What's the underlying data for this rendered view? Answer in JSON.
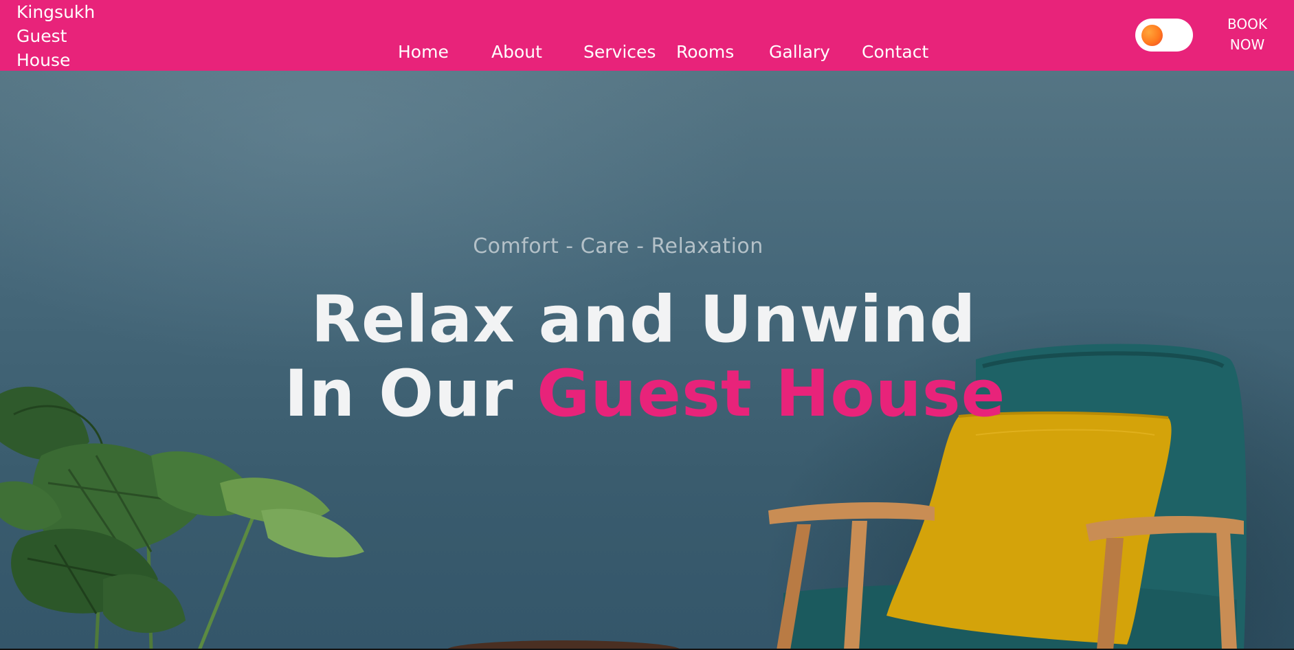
{
  "header": {
    "logo_lines": [
      "Kingsukh",
      "Guest",
      "House"
    ],
    "nav": [
      "Home",
      "About",
      "Services",
      "Rooms",
      "Gallary",
      "Contact"
    ],
    "book_now_lines": [
      "BOOK",
      "NOW"
    ],
    "theme_toggle": "theme-toggle"
  },
  "hero": {
    "tagline": "Comfort - Care - Relaxation",
    "headline_line1": "Relax and Unwind",
    "headline_line2_plain": "In Our",
    "headline_line2_accent": "Guest House"
  },
  "colors": {
    "brand": "#e8237a",
    "wall": "#46687a",
    "cushion": "#d4a30a",
    "chair": "#1e6266"
  },
  "icons": [
    "sun-toggle-icon"
  ]
}
